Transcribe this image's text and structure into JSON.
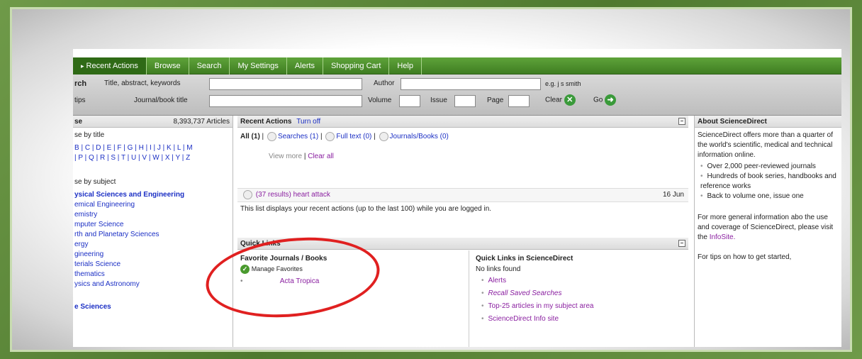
{
  "tabs": [
    {
      "label": "Recent Actions",
      "active": true
    },
    {
      "label": "Browse"
    },
    {
      "label": "Search"
    },
    {
      "label": "My Settings"
    },
    {
      "label": "Alerts"
    },
    {
      "label": "Shopping Cart"
    },
    {
      "label": "Help"
    }
  ],
  "search": {
    "title_label": "rch",
    "tips_label": "tips",
    "field1_label": "Title, abstract, keywords",
    "field2_label": "Journal/book title",
    "author_label": "Author",
    "author_hint": "e.g. j s smith",
    "volume_label": "Volume",
    "issue_label": "Issue",
    "page_label": "Page",
    "clear_label": "Clear",
    "go_label": "Go"
  },
  "browse": {
    "heading": "se",
    "count": "8,393,737 Articles",
    "by_title": "se by title",
    "letters_row1": "B | C | D | E | F | G | H | I | J | K | L | M",
    "letters_row2": "| P | Q | R | S | T | U | V | W | X | Y | Z",
    "by_subject": "se by subject",
    "category_bold": "ysical Sciences and Engineering",
    "subjects": [
      "emical Engineering",
      "emistry",
      "mputer Science",
      "rth and Planetary Sciences",
      "ergy",
      "gineering",
      "terials Science",
      "thematics",
      "ysics and Astronomy"
    ],
    "next_category": "e Sciences"
  },
  "recent": {
    "heading": "Recent Actions",
    "turn_off": "Turn off",
    "filter_all": "All (1)",
    "filter_searches": "Searches (1)",
    "filter_fulltext": "Full text (0)",
    "filter_journals": "Journals/Books (0)",
    "view_more": "View more",
    "clear_all": "Clear all",
    "item_text": "(37 results) heart attack",
    "item_date": "16 Jun",
    "footnote": "This list displays your recent actions (up to the last 100) while you are logged in."
  },
  "quick": {
    "heading": "Quick Links",
    "fav_heading": "Favorite Journals / Books",
    "manage": "Manage Favorites",
    "fav_item": "Acta Tropica",
    "sd_heading": "Quick Links in ScienceDirect",
    "no_links": "No links found",
    "sd_links": [
      "Alerts",
      "Recall Saved Searches",
      "Top-25 articles in my subject area",
      "ScienceDirect Info site"
    ]
  },
  "about": {
    "heading": "About ScienceDirect",
    "intro": "ScienceDirect offers more than a quarter of the world's scientific, medical and technical information online.",
    "bullets": [
      "Over 2,000 peer-reviewed journals",
      "Hundreds of book series, handbooks and reference works",
      "Back to volume one, issue one"
    ],
    "more_info_pre": "For more general information abo the use and coverage of ScienceDirect, please visit the",
    "infosite": "InfoSite.",
    "tips": "For tips on how to get started,"
  },
  "colors": {
    "accent_green": "#3f7d21",
    "highlight_red": "#e02020",
    "link_blue": "#1b2fc4",
    "visited_purple": "#8a1fa0"
  }
}
